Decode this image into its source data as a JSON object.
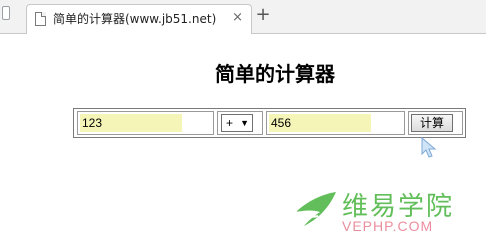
{
  "browser": {
    "tab_title": "简单的计算器(www.jb51.net)",
    "close_glyph": "×",
    "new_tab_glyph": "+"
  },
  "page": {
    "heading": "简单的计算器"
  },
  "calculator": {
    "operand1": "123",
    "operator": "+",
    "operator_caret": "▼",
    "operand2": "456",
    "compute_button": "计算"
  },
  "watermark": {
    "cn_text": "维易学院",
    "en_text": "VEPHP.COM",
    "brand_green": "#46b33d",
    "brand_pink": "#e87a8e"
  }
}
